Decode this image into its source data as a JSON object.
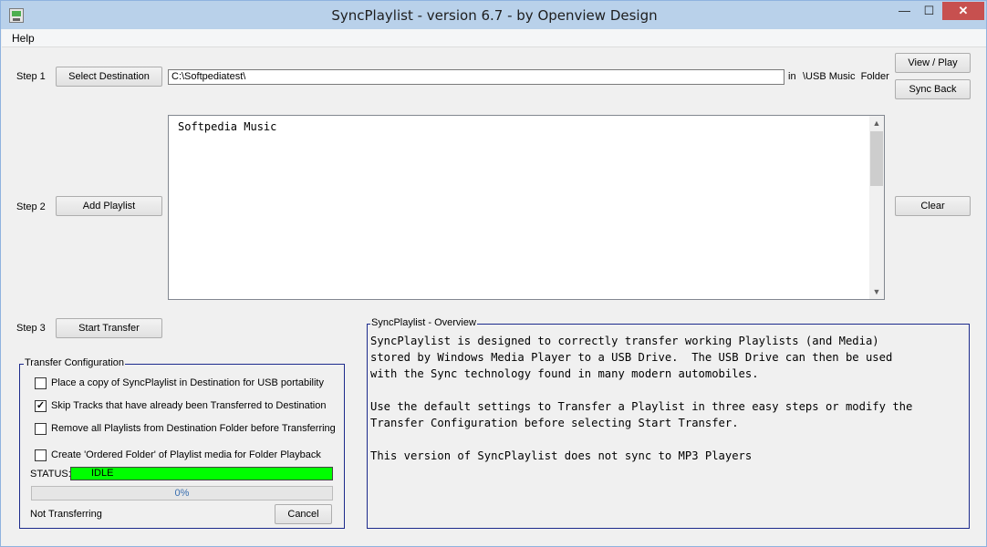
{
  "window": {
    "title": "SyncPlaylist - version 6.7 - by Openview Design",
    "min_glyph": "—",
    "max_glyph": "☐",
    "close_glyph": "✕"
  },
  "menu": {
    "help": "Help"
  },
  "step1": {
    "label": "Step 1",
    "button": "Select Destination",
    "destination": "C:\\Softpediatest\\",
    "in_label": "in",
    "folder_label": "\\USB Music  Folder"
  },
  "step2": {
    "label": "Step 2",
    "button": "Add Playlist",
    "playlists": [
      "Softpedia Music"
    ]
  },
  "step3": {
    "label": "Step 3",
    "button": "Start Transfer"
  },
  "right_buttons": {
    "view_play": "View / Play",
    "sync_back": "Sync Back",
    "clear": "Clear"
  },
  "config": {
    "title": "Transfer Configuration",
    "options": [
      {
        "label": "Place a copy of SyncPlaylist in Destination for USB portability",
        "checked": false
      },
      {
        "label": "Skip Tracks that have already been Transferred to Destination",
        "checked": true
      },
      {
        "label": "Remove all Playlists from Destination Folder before Transferring",
        "checked": false
      },
      {
        "label": "Create 'Ordered Folder' of Playlist media for Folder Playback",
        "checked": false
      }
    ],
    "status_label": "STATUS:",
    "status_value": "IDLE",
    "status_color": "#00ff00",
    "progress_value": 0,
    "progress_text": "0%",
    "state_text": "Not Transferring",
    "cancel": "Cancel"
  },
  "overview": {
    "title": "SyncPlaylist - Overview",
    "text": "SyncPlaylist is designed to correctly transfer working Playlists (and Media)\nstored by Windows Media Player to a USB Drive.  The USB Drive can then be used\nwith the Sync technology found in many modern automobiles.\n\nUse the default settings to Transfer a Playlist in three easy steps or modify the\nTransfer Configuration before selecting Start Transfer.\n\nThis version of SyncPlaylist does not sync to MP3 Players"
  },
  "colors": {
    "group_border": "#1c2a8c",
    "title_bar": "#b9d1ea",
    "close_button": "#c7504f"
  }
}
